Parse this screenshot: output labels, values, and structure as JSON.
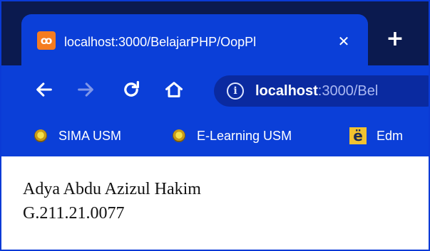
{
  "tab": {
    "favicon": "xampp-icon",
    "title": "localhost:3000/BelajarPHP/OopPl",
    "close": "✕"
  },
  "new_tab": "+",
  "toolbar": {
    "back_icon": "arrow-left-icon",
    "forward_icon": "arrow-right-icon",
    "reload_icon": "reload-icon",
    "home_icon": "home-icon",
    "info_icon": "info-icon",
    "url_host": "localhost",
    "url_path": ":3000/Bel"
  },
  "bookmarks": [
    {
      "label": "SIMA USM",
      "icon": "usm-logo-icon"
    },
    {
      "label": "E-Learning USM",
      "icon": "usm-logo-icon"
    },
    {
      "label": "Edm",
      "icon": "edmodo-icon",
      "glyph": "ё"
    }
  ],
  "content": {
    "name": "Adya Abdu Azizul Hakim",
    "id": "G.211.21.0077"
  },
  "colors": {
    "tab_strip": "#0b1a4f",
    "toolbar": "#0b3fd8",
    "omnibox": "#0a2aa0",
    "favicon": "#f57c20"
  }
}
